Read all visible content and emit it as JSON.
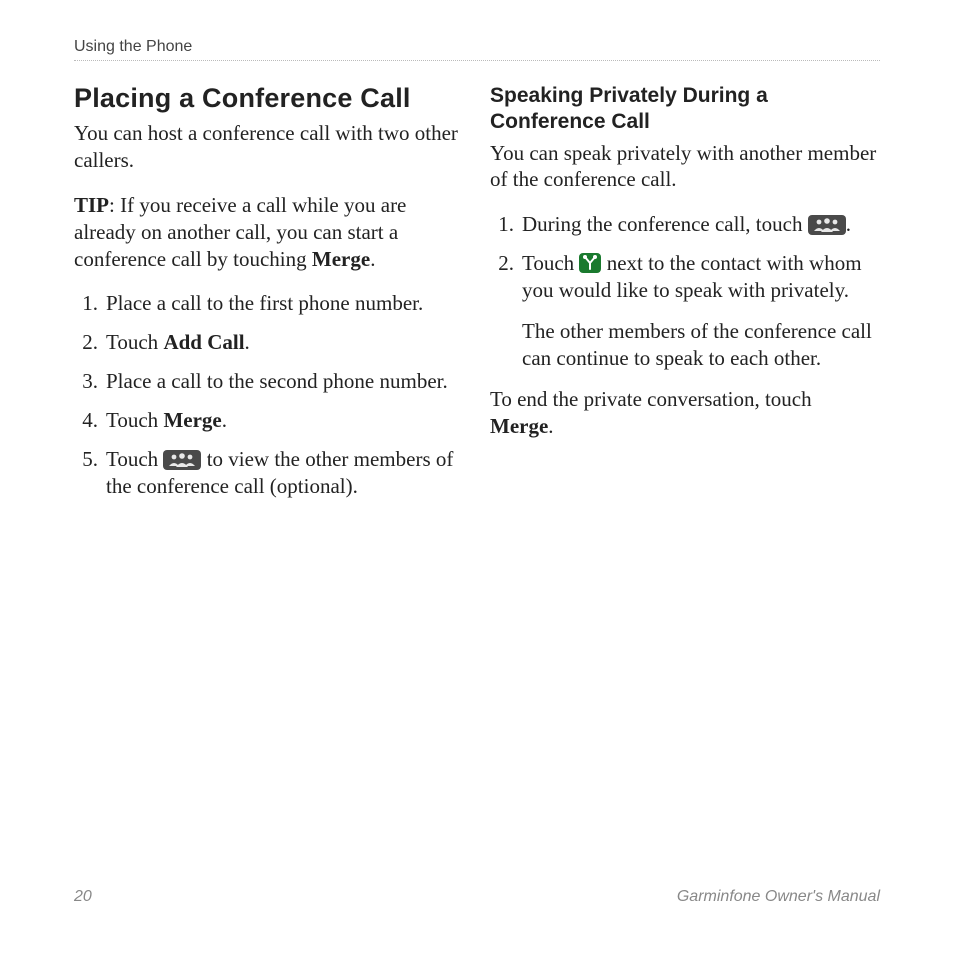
{
  "header": {
    "section": "Using the Phone"
  },
  "left": {
    "heading": "Placing a Conference Call",
    "intro": "You can host a conference call with two other callers.",
    "tip_label": "TIP",
    "tip_sep": ": ",
    "tip_a": "If you receive a call while you are already on another call, you can start a conference call by touching ",
    "tip_bold": "Merge",
    "tip_b": ".",
    "steps": {
      "s1": "Place a call to the first phone number.",
      "s2a": "Touch ",
      "s2b": "Add Call",
      "s2c": ".",
      "s3": "Place a call to the second phone number.",
      "s4a": "Touch ",
      "s4b": "Merge",
      "s4c": ".",
      "s5a": "Touch ",
      "s5b": " to view the other members of the conference call (optional)."
    }
  },
  "right": {
    "heading": "Speaking Privately During a Conference Call",
    "intro": "You can speak privately with another member of the conference call.",
    "steps": {
      "s1a": "During the conference call, touch ",
      "s1b": ".",
      "s2a": "Touch ",
      "s2b": " next to the contact with whom you would like to speak with privately.",
      "cont": "The other members of the conference call can continue to speak to each other."
    },
    "closing_a": "To end the private conversation, touch ",
    "closing_bold": "Merge",
    "closing_b": "."
  },
  "footer": {
    "page": "20",
    "title": "Garminfone Owner's Manual"
  }
}
